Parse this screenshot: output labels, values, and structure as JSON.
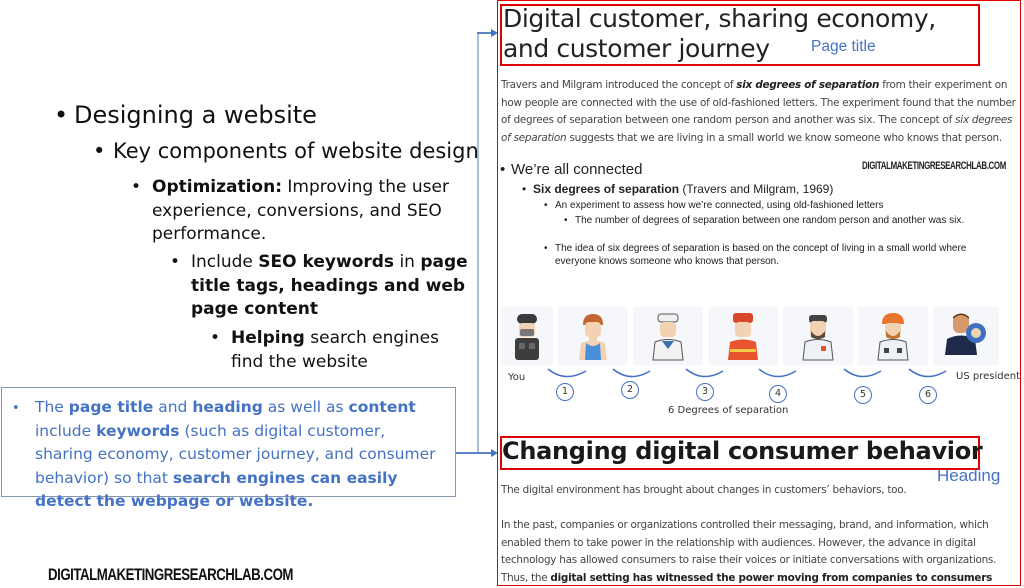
{
  "slide": {
    "outline": [
      {
        "level": 1,
        "text": "Designing a website"
      },
      {
        "level": 2,
        "text": "Key components of website design"
      },
      {
        "level": 3,
        "bold": "Optimization:",
        "text": " Improving the user experience, conversions, and SEO performance."
      },
      {
        "level": 4,
        "parts": [
          "Include ",
          "SEO keywords",
          " in ",
          "page title tags, headings and web page content"
        ]
      },
      {
        "level": 5,
        "bold": "Helping",
        "text": " search engines find the website"
      }
    ],
    "callout": {
      "bullet": "•",
      "parts": [
        "The ",
        "page title",
        " and ",
        "heading",
        " as well as ",
        "content",
        " include ",
        "keywords",
        " (such as digital customer, sharing economy, customer journey, and consumer behavior) so that ",
        "search engines can easily detect the webpage or website."
      ]
    },
    "logo": "DIGITALMAKETINGRESEARCHLAB.COM",
    "colors": {
      "accent_blue": "#4472c4",
      "highlight_red": "#e00000",
      "connector": "#a9bfe0"
    }
  },
  "webpage": {
    "title": "Digital customer, sharing economy, and customer journey",
    "title_annotation": "Page title",
    "intro": {
      "parts": [
        "Travers and Milgram introduced the concept of ",
        "six degrees of separation",
        " from their experiment on how people are connected with the use of old-fashioned letters. The experiment found that the number of degrees of separation between one random person and another was six. The concept of ",
        "six degrees of separation",
        " suggests that we are living in a small world we know someone who knows that person."
      ]
    },
    "embedded_slide": {
      "watermark": "DIGITALMAKETINGRESEARCHLAB.COM",
      "bullet1": "We’re all connected",
      "bullet2_bold": "Six degrees of separation",
      "bullet2_rest": " (Travers and Milgram, 1969)",
      "bullet3": "An experiment to assess how we’re connected, using old-fashioned letters",
      "bullet4": "The number of degrees of separation between one random person and another was six.",
      "bullet5": "The idea of six degrees of separation is based on the concept of living in a small world where everyone knows someone who knows that person."
    },
    "diagram": {
      "people": [
        "soldier",
        "athlete",
        "sailor",
        "firefighter",
        "worker",
        "construction-worker",
        "us-president"
      ],
      "start_label": "You",
      "end_label": "US president",
      "hops": [
        "1",
        "2",
        "3",
        "4",
        "5",
        "6"
      ],
      "caption": "6 Degrees of separation"
    },
    "heading": "Changing digital consumer behavior",
    "heading_annotation": "Heading",
    "para_env": "The digital environment has brought about changes in customers’ behaviors, too.",
    "para_past": {
      "text": "In the past, companies or organizations controlled their messaging, brand, and information, which enabled them to take power in the relationship with audiences. However, the advance in digital technology has allowed consumers to raise their voices or initiate conversations with organizations. Thus, the ",
      "bold": "digital setting has witnessed the power moving from companies to consumers"
    }
  }
}
